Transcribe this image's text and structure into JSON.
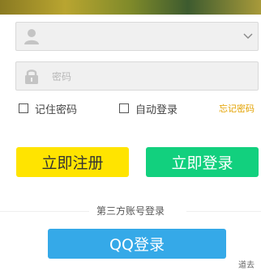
{
  "form": {
    "username": {
      "value": "",
      "placeholder": ""
    },
    "password": {
      "value": "",
      "placeholder": "密码"
    }
  },
  "options": {
    "remember_label": "记住密码",
    "auto_login_label": "自动登录",
    "forgot_label": "忘记密码"
  },
  "buttons": {
    "register_label": "立即注册",
    "login_label": "立即登录",
    "qq_login_label": "QQ登录"
  },
  "third_party": {
    "label": "第三方账号登录"
  },
  "corner_text": "道去",
  "colors": {
    "register_bg": "#ffe400",
    "login_bg": "#12d07e",
    "qq_bg": "#35a9e8",
    "forgot_link": "#e3a200"
  },
  "icons": [
    "user-icon",
    "chevron-down-icon",
    "lock-icon"
  ]
}
